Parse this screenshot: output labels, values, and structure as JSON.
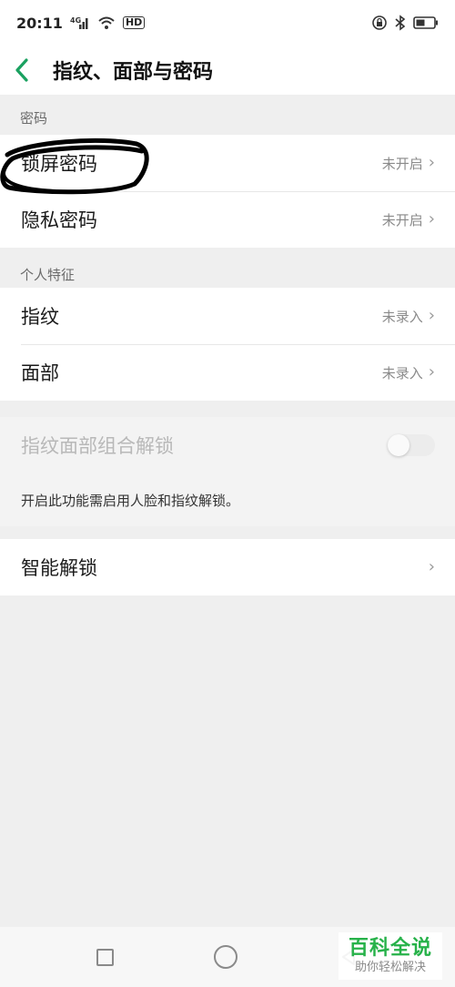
{
  "status_bar": {
    "time": "20:11",
    "network_label": "4G",
    "hd_label": "HD"
  },
  "header": {
    "title": "指纹、面部与密码"
  },
  "sections": {
    "password": {
      "label": "密码",
      "items": [
        {
          "label": "锁屏密码",
          "value": "未开启"
        },
        {
          "label": "隐私密码",
          "value": "未开启"
        }
      ]
    },
    "biometrics": {
      "label": "个人特征",
      "items": [
        {
          "label": "指纹",
          "value": "未录入"
        },
        {
          "label": "面部",
          "value": "未录入"
        }
      ]
    },
    "combo": {
      "label": "指纹面部组合解锁",
      "enabled": false,
      "helper": "开启此功能需启用人脸和指纹解锁。"
    },
    "smart": {
      "label": "智能解锁"
    }
  },
  "watermark": {
    "title": "百科全说",
    "subtitle": "助你轻松解决"
  },
  "colors": {
    "accent": "#1aa160",
    "background": "#efefef",
    "watermark_green": "#27b24a"
  }
}
